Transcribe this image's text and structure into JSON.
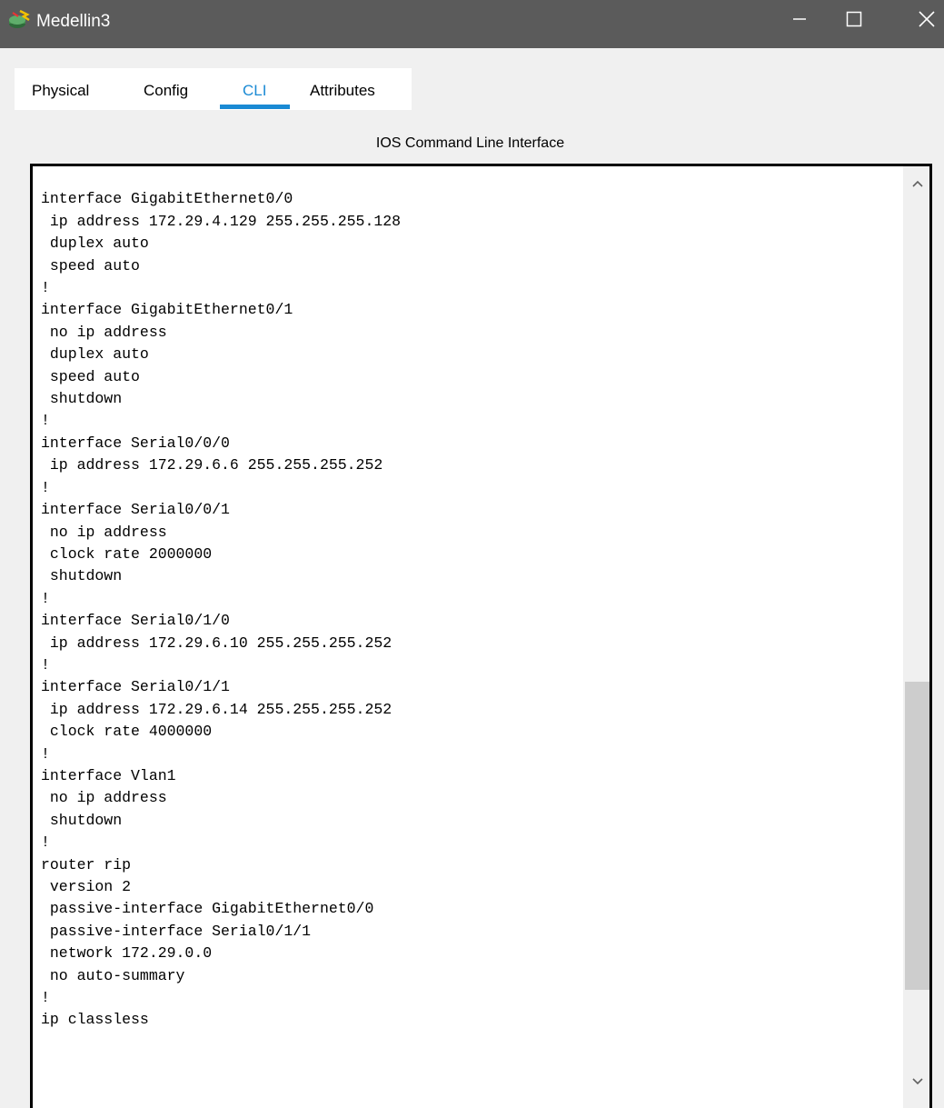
{
  "window": {
    "title": "Medellin3",
    "icon": "router-device-icon",
    "controls": [
      "minimize-icon",
      "maximize-icon",
      "close-icon"
    ]
  },
  "tabs": [
    {
      "label": "Physical"
    },
    {
      "label": "Config"
    },
    {
      "label": "CLI",
      "active": true
    },
    {
      "label": "Attributes"
    }
  ],
  "accent_color": "#1a8ad4",
  "cli": {
    "heading": "IOS Command Line Interface",
    "lines": [
      "!",
      "interface GigabitEthernet0/0",
      " ip address 172.29.4.129 255.255.255.128",
      " duplex auto",
      " speed auto",
      "!",
      "interface GigabitEthernet0/1",
      " no ip address",
      " duplex auto",
      " speed auto",
      " shutdown",
      "!",
      "interface Serial0/0/0",
      " ip address 172.29.6.6 255.255.255.252",
      "!",
      "interface Serial0/0/1",
      " no ip address",
      " clock rate 2000000",
      " shutdown",
      "!",
      "interface Serial0/1/0",
      " ip address 172.29.6.10 255.255.255.252",
      "!",
      "interface Serial0/1/1",
      " ip address 172.29.6.14 255.255.255.252",
      " clock rate 4000000",
      "!",
      "interface Vlan1",
      " no ip address",
      " shutdown",
      "!",
      "router rip",
      " version 2",
      " passive-interface GigabitEthernet0/0",
      " passive-interface Serial0/1/1",
      " network 172.29.0.0",
      " no auto-summary",
      "!",
      "ip classless"
    ]
  },
  "scrollbar": {
    "up_icon": "chevron-up-icon",
    "down_icon": "chevron-down-icon",
    "position_fraction": 0.57
  }
}
